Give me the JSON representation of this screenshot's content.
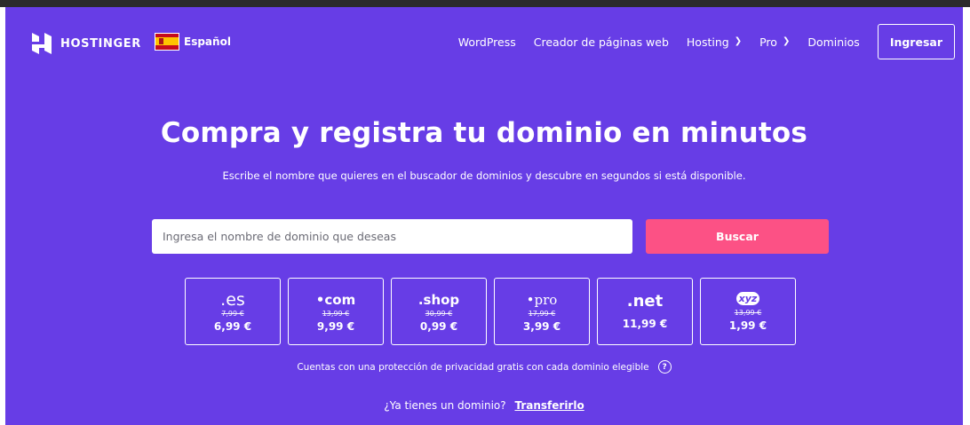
{
  "header": {
    "brand": "HOSTINGER",
    "language": "Español",
    "nav": [
      {
        "label": "WordPress",
        "dropdown": false
      },
      {
        "label": "Creador de páginas web",
        "dropdown": false
      },
      {
        "label": "Hosting",
        "dropdown": true
      },
      {
        "label": "Pro",
        "dropdown": true
      },
      {
        "label": "Dominios",
        "dropdown": false
      }
    ],
    "login_label": "Ingresar"
  },
  "hero": {
    "title": "Compra y registra tu dominio en minutos",
    "subtitle": "Escribe el nombre que quieres en el buscador de dominios y descubre en segundos si está disponible.",
    "search_placeholder": "Ingresa el nombre de dominio que deseas",
    "search_button": "Buscar"
  },
  "tlds": [
    {
      "name": ".es",
      "old_price": "7,99 €",
      "price": "6,99 €"
    },
    {
      "name": "•com",
      "old_price": "13,99 €",
      "price": "9,99 €"
    },
    {
      "name": ".shop",
      "old_price": "30,99 €",
      "price": "0,99 €"
    },
    {
      "name": "•pro",
      "old_price": "17,99 €",
      "price": "3,99 €"
    },
    {
      "name": ".net",
      "old_price": "",
      "price": "11,99 €"
    },
    {
      "name": "xyz",
      "old_price": "13,99 €",
      "price": "1,99 €"
    }
  ],
  "privacy_text": "Cuentas con una protección de privacidad gratis con cada dominio elegible",
  "transfer": {
    "question": "¿Ya tienes un dominio?",
    "link": "Transferirlo"
  },
  "colors": {
    "background": "#673de6",
    "accent": "#fc5185",
    "text": "#ffffff"
  },
  "icons": [
    "hostinger-logo-icon",
    "spain-flag-icon",
    "chevron-down-icon",
    "help-icon"
  ]
}
